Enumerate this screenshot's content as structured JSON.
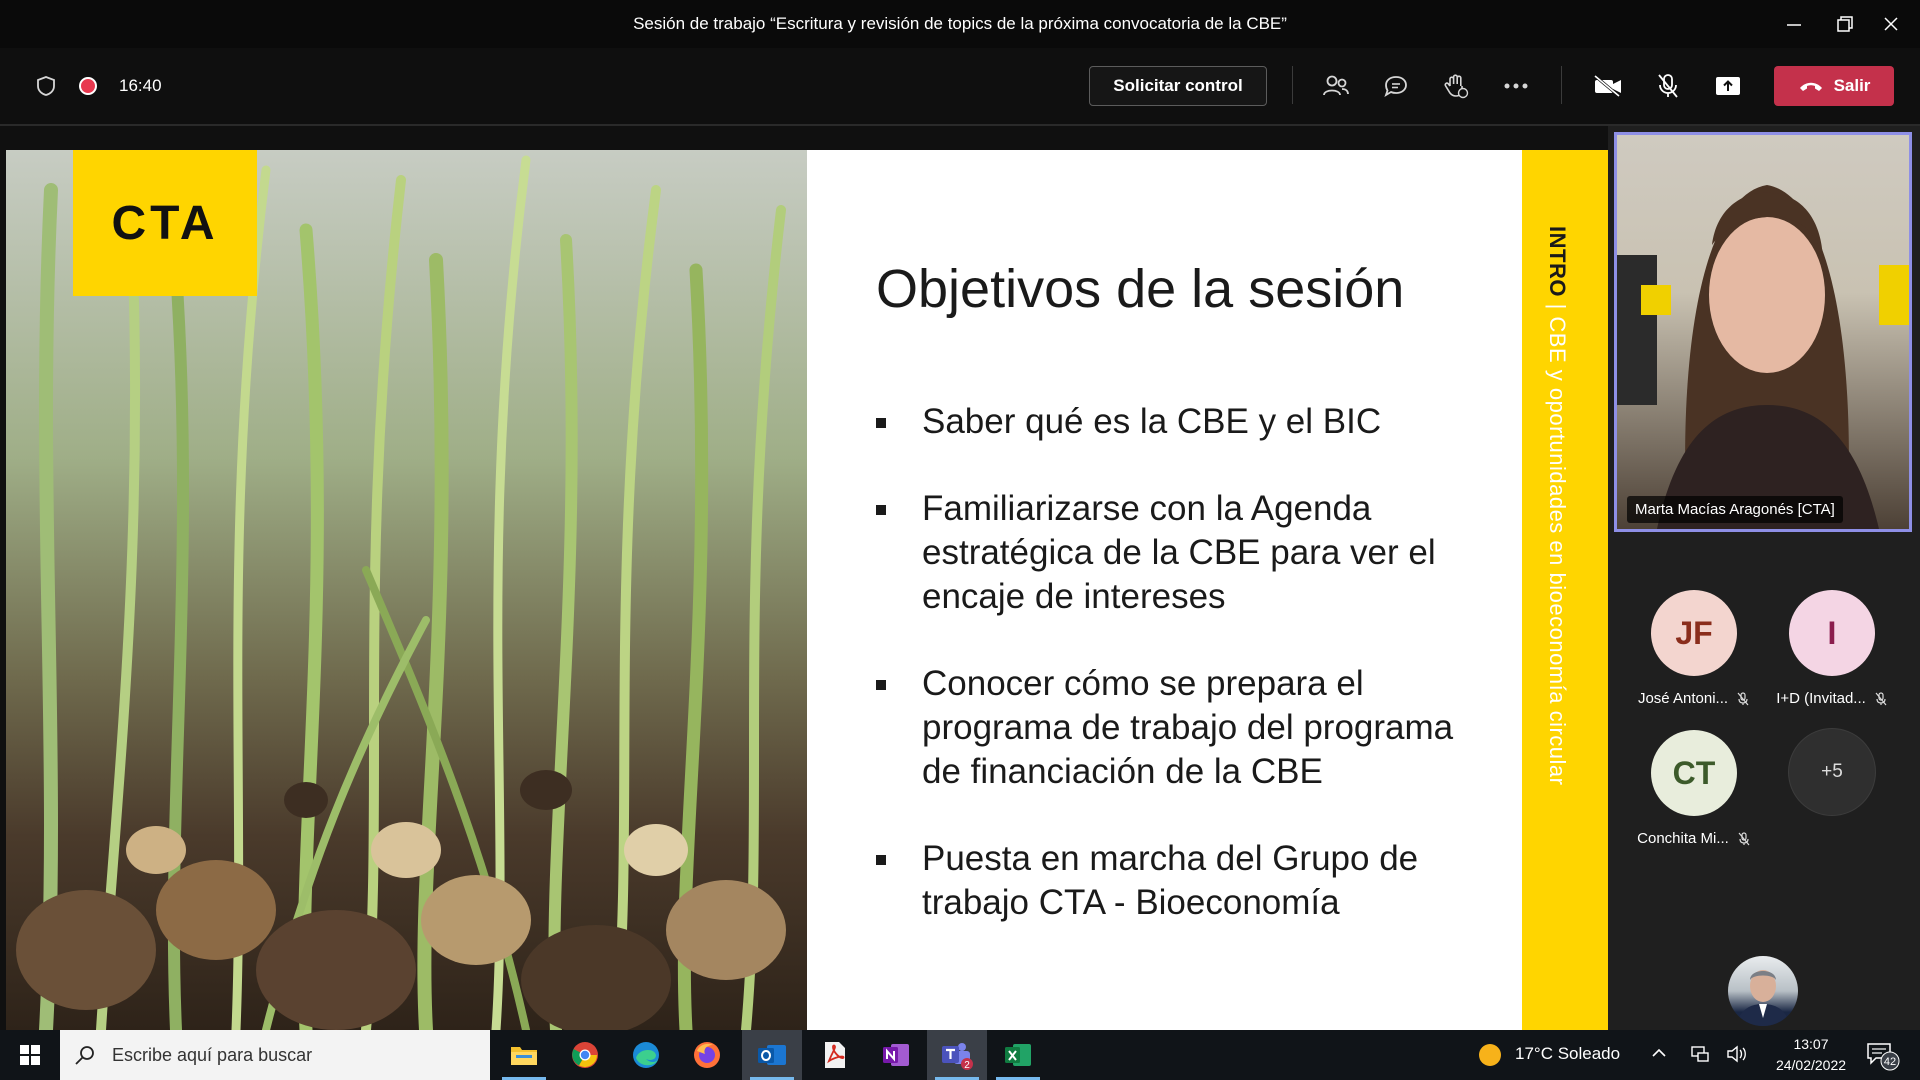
{
  "window": {
    "title": "Sesión de trabajo “Escritura y revisión de topics de la próxima convocatoria de la CBE”",
    "controls": [
      "minimize-icon",
      "restore-icon",
      "close-icon"
    ]
  },
  "meeting": {
    "timer": "16:40",
    "request_control_label": "Solicitar control",
    "leave_label": "Salir",
    "toolbar_icons": [
      "people-icon",
      "chat-icon",
      "raise-hand-icon",
      "more-icon",
      "camera-off-icon",
      "mic-off-icon",
      "share-icon"
    ],
    "accent_leave": "#c4314b"
  },
  "slide": {
    "logo": "CTA",
    "title": "Objetivos de la sesión",
    "bullets": [
      "Saber qué es la CBE y el BIC",
      "Familiarizarse con la Agenda estratégica de la CBE para ver el encaje de intereses",
      "Conocer cómo se prepara el programa de trabajo del programa de financiación de la CBE",
      "Puesta en marcha del Grupo de trabajo CTA - Bioeconomía"
    ],
    "side_label_bold": "INTRO",
    "side_label_sep": " | ",
    "side_label_rest": "CBE y oportunidades en bioeconomía circular",
    "accent_color": "#ffd500"
  },
  "participants": {
    "speaker_name": "Marta Macías Aragonés [CTA]",
    "tiles": [
      {
        "initials": "JF",
        "name": "José Antoni...",
        "bg": "#f3d5cf",
        "fg": "#8a2d1c"
      },
      {
        "initials": "I",
        "name": "I+D (Invitad...",
        "bg": "#f4d5e4",
        "fg": "#8b1d4d"
      },
      {
        "initials": "CT",
        "name": "Conchita Mi...",
        "bg": "#e8eddc",
        "fg": "#3c5a2a"
      }
    ],
    "more_count": "+5"
  },
  "taskbar": {
    "search_placeholder": "Escribe aquí para buscar",
    "apps": [
      "file-explorer-icon",
      "chrome-icon",
      "edge-icon",
      "firefox-icon",
      "outlook-icon",
      "acrobat-icon",
      "onenote-icon",
      "teams-icon",
      "excel-icon"
    ],
    "weather": "17°C  Soleado",
    "time": "13:07",
    "date": "24/02/2022",
    "notifications": "42",
    "teams_badge": "2"
  }
}
